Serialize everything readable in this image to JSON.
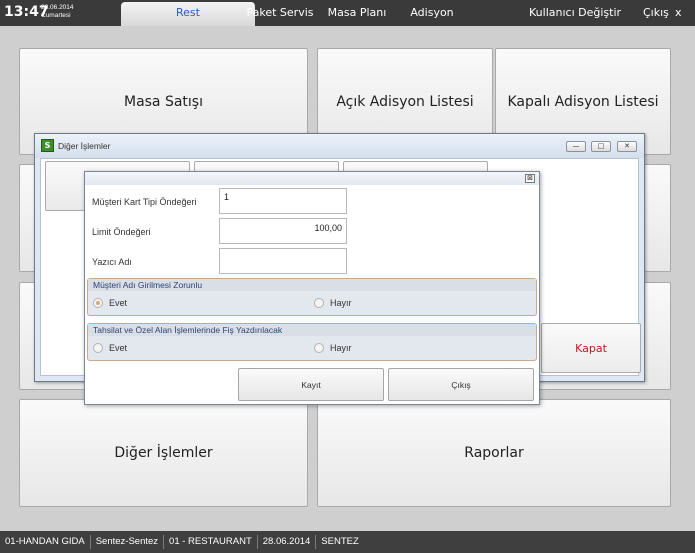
{
  "topbar": {
    "time": "13:47",
    "date": "28.06.2014",
    "day": "Cumartesi",
    "tabs": [
      "Rest",
      "Paket Servis",
      "Masa Planı",
      "Adisyon"
    ],
    "active_tab": "Rest",
    "user_label": "Kullanıcı Değiştir",
    "exit_label": "Çıkış",
    "close_label": "x"
  },
  "tiles": {
    "masa_satisi": "Masa Satışı",
    "acik_adisyon": "Açık Adisyon Listesi",
    "kapali_adisyon": "Kapalı Adisyon Listesi",
    "diger_islemler": "Diğer İşlemler",
    "raporlar": "Raporlar"
  },
  "window": {
    "title": "Diğer İşlemler",
    "icon": "spreadsheet-icon",
    "kapat_label": "Kapat"
  },
  "dialog": {
    "close_glyph": "⊠",
    "fields": {
      "kart_tipi_label": "Müşteri Kart Tipi Öndeğeri",
      "kart_tipi_value": "1",
      "limit_label": "Limit Öndeğeri",
      "limit_value": "100,00",
      "yazici_label": "Yazıcı Adı",
      "yazici_value": ""
    },
    "group1": {
      "title": "Müşteri Adı Girilmesi Zorunlu",
      "option_yes": "Evet",
      "option_no": "Hayır",
      "selected": "Evet"
    },
    "group2": {
      "title": "Tahsilat ve Özel Alan İşlemlerinde Fiş Yazdırılacak",
      "option_yes": "Evet",
      "option_no": "Hayır",
      "selected": ""
    },
    "save_label": "Kayıt",
    "exit_label": "Çıkış"
  },
  "statusbar": [
    "01-HANDAN GIDA",
    "Sentez-Sentez",
    "01 - RESTAURANT",
    "28.06.2014",
    "SENTEZ"
  ],
  "colors": {
    "accent_blue": "#2a5db8",
    "kapat_red": "#c8141e",
    "radio_selected": "#e0a66d"
  }
}
